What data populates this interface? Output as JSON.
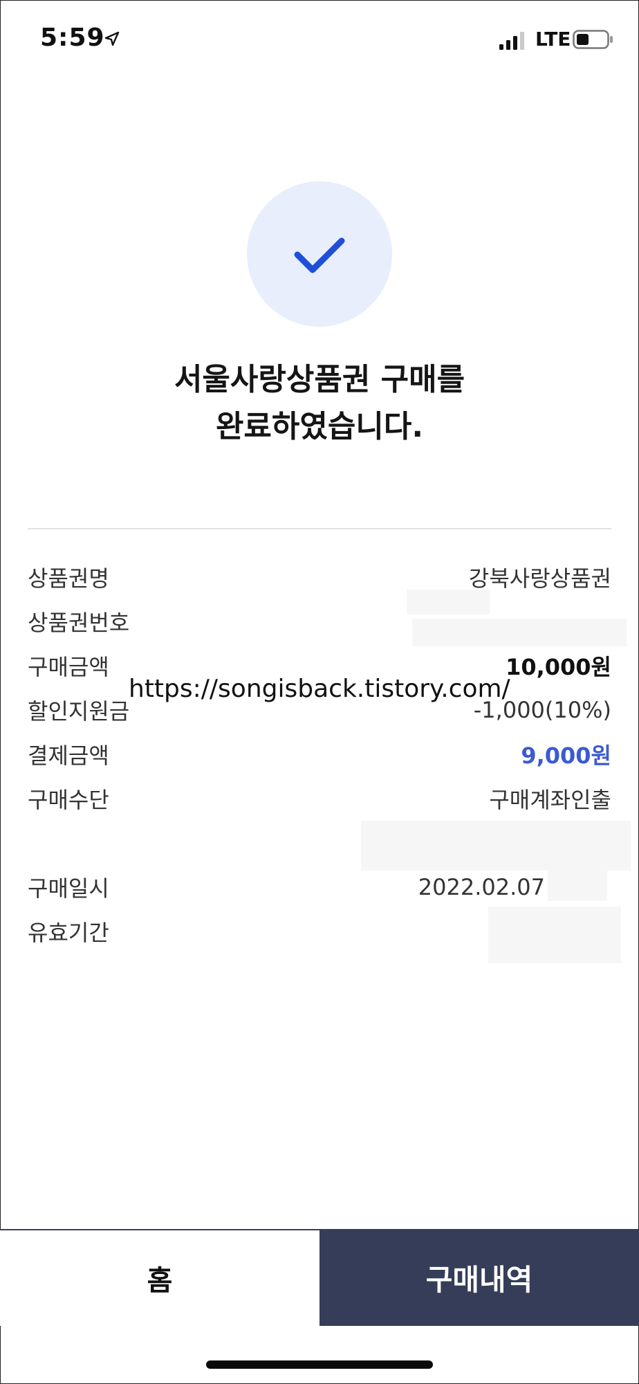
{
  "status_bar": {
    "time": "5:59",
    "network": "LTE"
  },
  "headline": {
    "line1": "서울사랑상품권 구매를",
    "line2": "완료하였습니다."
  },
  "details": [
    {
      "label": "상품권명",
      "value": "강북사랑상품권"
    },
    {
      "label": "상품권번호",
      "value": ""
    },
    {
      "label": "구매금액",
      "value": "10,000원"
    },
    {
      "label": "할인지원금",
      "value": "-1,000(10%)"
    },
    {
      "label": "결제금액",
      "value": "9,000원"
    },
    {
      "label": "구매수단",
      "value": "구매계좌인출"
    },
    {
      "label": "",
      "value": ""
    },
    {
      "label": "구매일시",
      "value": "2022.02.07"
    },
    {
      "label": "유효기간",
      "value": ""
    }
  ],
  "watermark": "https://songisback.tistory.com/",
  "buttons": {
    "home": "홈",
    "history": "구매내역"
  },
  "colors": {
    "accent": "#3c5ad0",
    "success_bg": "#e8eefc",
    "check": "#1f4fd8",
    "primary_button": "#353d58"
  },
  "icons": {
    "status": [
      "location-arrow-icon",
      "signal-bars-icon",
      "battery-icon"
    ],
    "success": "checkmark-icon"
  }
}
